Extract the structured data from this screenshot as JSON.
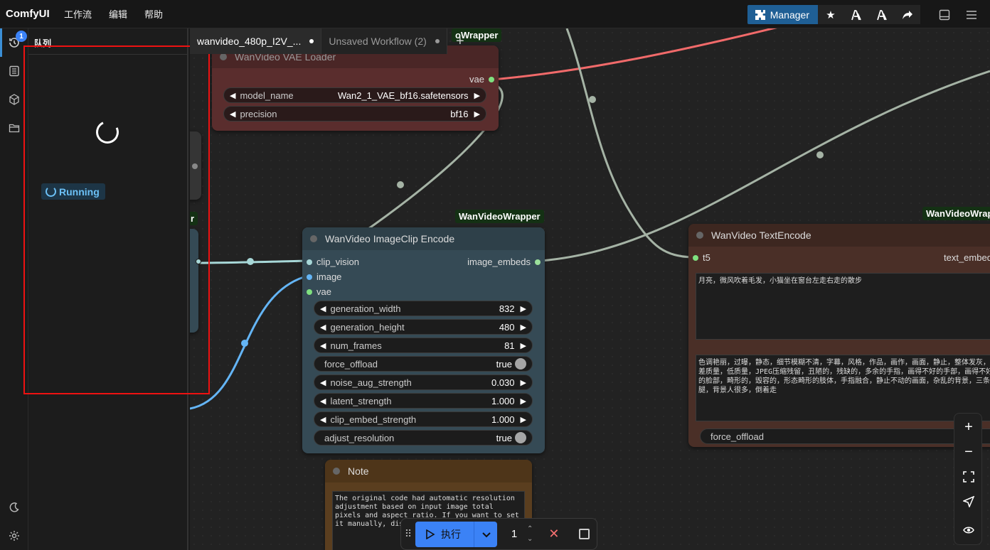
{
  "app": {
    "brand": "ComfyUI",
    "menu": [
      "工作流",
      "编辑",
      "帮助"
    ]
  },
  "toolbar": {
    "manager_label": "Manager",
    "icons": [
      "star-icon",
      "badge-icon",
      "badge-alt-icon",
      "share-icon",
      "toggle-bottom-panel-icon",
      "hamburger-menu-icon"
    ]
  },
  "rail": {
    "queue_badge": "1",
    "items": [
      "queue-icon",
      "node-library-icon",
      "model-library-icon",
      "workflows-icon"
    ],
    "bottom": [
      "theme-toggle-icon",
      "settings-icon"
    ]
  },
  "queue": {
    "title": "队列",
    "status": "Running"
  },
  "tabs": [
    {
      "label": "wanvideo_480p_I2V_...",
      "active": true
    },
    {
      "label": "Unsaved Workflow (2)",
      "active": false
    }
  ],
  "nodes": {
    "vae_loader": {
      "badge": "oWrapper",
      "title": "WanVideo VAE Loader",
      "output": "vae",
      "widgets": [
        {
          "name": "model_name",
          "value": "Wan2_1_VAE_bf16.safetensors"
        },
        {
          "name": "precision",
          "value": "bf16"
        }
      ]
    },
    "partial_left": {
      "badge": "r"
    },
    "clip_encode": {
      "badge": "WanVideoWrapper",
      "title": "WanVideo ImageClip Encode",
      "inputs": [
        "clip_vision",
        "image",
        "vae"
      ],
      "output": "image_embeds",
      "widgets": [
        {
          "name": "generation_width",
          "value": "832"
        },
        {
          "name": "generation_height",
          "value": "480"
        },
        {
          "name": "num_frames",
          "value": "81"
        },
        {
          "name": "force_offload",
          "value": "true"
        },
        {
          "name": "noise_aug_strength",
          "value": "0.030"
        },
        {
          "name": "latent_strength",
          "value": "1.000"
        },
        {
          "name": "clip_embed_strength",
          "value": "1.000"
        },
        {
          "name": "adjust_resolution",
          "value": "true"
        }
      ]
    },
    "text_encode": {
      "badge": "WanVideoWrap",
      "title": "WanVideo TextEncode",
      "input": "t5",
      "output": "text_embed",
      "positive_prompt": "月亮，微风吹着毛发，小猫坐在窗台左走右走的散步",
      "negative_prompt": "色调艳丽，过曝，静态，细节模糊不清，字幕，风格，作品，画作，画面，静止，整体发灰，最差质量，低质量，JPEG压缩残留，丑陋的，残缺的，多余的手指，画得不好的手部，画得不好的脸部，畸形的，毁容的，形态畸形的肢体，手指融合，静止不动的画面，杂乱的背景，三条腿，背景人很多，倒着走",
      "widget_force_offload": "force_offload"
    },
    "note": {
      "title": "Note",
      "text": "The original code had automatic resolution adjustment based on input image total pixels and aspect ratio. If you want to set it manually, disable"
    }
  },
  "runbar": {
    "run_label": "执行",
    "count": "1"
  },
  "canvas_controls": [
    "zoom-in-icon",
    "zoom-out-icon",
    "fit-view-icon",
    "select-mode-icon",
    "toggle-links-icon"
  ],
  "colors": {
    "accent": "#3b82f6",
    "manager": "#1f5f95",
    "vae_node": "#5a2d2d",
    "clip_node": "#354a55",
    "text_node": "#4a2f27",
    "note_node": "#5a3e1f",
    "running": "#6cc0f5",
    "highlight": "#ee1111"
  }
}
